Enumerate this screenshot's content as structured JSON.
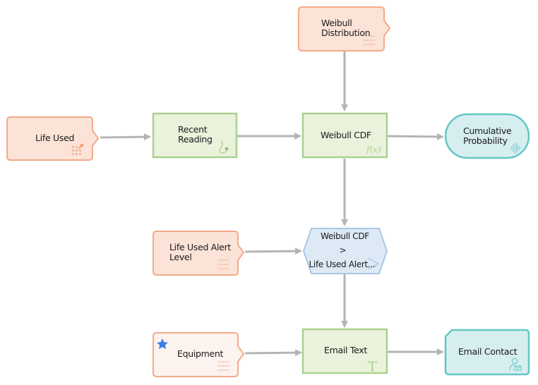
{
  "diagram": {
    "colors": {
      "input_fill": "#fbe3d7",
      "input_stroke": "#f3a98a",
      "input_light_fill": "#fdf3ee",
      "calc_fill": "#eaf2dc",
      "calc_stroke": "#a9d18e",
      "condition_fill": "#dde9f5",
      "condition_stroke": "#a9c8e6",
      "output_fill": "#d6eef0",
      "output_stroke": "#63c7c4",
      "connector": "#b5b5b5",
      "star": "#3a7fe0"
    },
    "nodes": [
      {
        "id": "weibull-distribution",
        "type": "input",
        "label_lines": [
          "Weibull",
          "Distribution"
        ],
        "icon": "list-lines-icon"
      },
      {
        "id": "life-used",
        "type": "input",
        "label_lines": [
          "Life Used"
        ],
        "icon": "grid-dots-icon"
      },
      {
        "id": "recent-reading",
        "type": "calculation",
        "label_lines": [
          "Recent",
          "Reading"
        ],
        "icon": "reading-hook-icon"
      },
      {
        "id": "weibull-cdf",
        "type": "calculation",
        "label_lines": [
          "Weibull CDF"
        ],
        "icon": "function-fx-icon",
        "icon_text": "f(x)"
      },
      {
        "id": "cumulative-probability",
        "type": "output",
        "label_lines": [
          "Cumulative",
          "Probability"
        ],
        "icon": "diamond-arrow-icon"
      },
      {
        "id": "life-used-alert-level",
        "type": "input",
        "label_lines": [
          "Life Used Alert",
          "Level"
        ],
        "icon": "list-lines-icon"
      },
      {
        "id": "comparison",
        "type": "condition",
        "label_lines": [
          "Weibull CDF",
          ">",
          "Life Used Alert..."
        ],
        "icon": "chevron-right-icon"
      },
      {
        "id": "equipment",
        "type": "input-light",
        "label_lines": [
          "Equipment"
        ],
        "icon": "list-lines-icon",
        "badge": "star-icon"
      },
      {
        "id": "email-text",
        "type": "calculation",
        "label_lines": [
          "Email Text"
        ],
        "icon": "text-t-icon",
        "icon_text": "T"
      },
      {
        "id": "email-contact",
        "type": "output-action",
        "label_lines": [
          "Email Contact"
        ],
        "icon": "person-email-icon"
      }
    ],
    "edges": [
      {
        "from": "weibull-distribution",
        "to": "weibull-cdf"
      },
      {
        "from": "life-used",
        "to": "recent-reading"
      },
      {
        "from": "recent-reading",
        "to": "weibull-cdf"
      },
      {
        "from": "weibull-cdf",
        "to": "cumulative-probability"
      },
      {
        "from": "weibull-cdf",
        "to": "comparison"
      },
      {
        "from": "life-used-alert-level",
        "to": "comparison"
      },
      {
        "from": "comparison",
        "to": "email-text"
      },
      {
        "from": "equipment",
        "to": "email-text"
      },
      {
        "from": "email-text",
        "to": "email-contact"
      }
    ]
  }
}
